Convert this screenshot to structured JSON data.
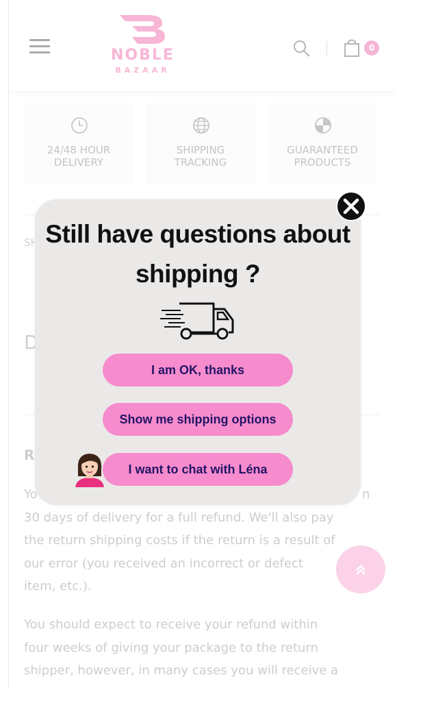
{
  "header": {
    "logo_name": "NOBLE",
    "logo_sub": "BAZAAR",
    "cart_count": "0"
  },
  "features": [
    {
      "icon": "clock-icon",
      "line1": "24/48 HOUR",
      "line2": "DELIVERY"
    },
    {
      "icon": "globe-icon",
      "line1": "SHIPPING",
      "line2": "TRACKING"
    },
    {
      "icon": "shield-icon",
      "line1": "GUARANTEED",
      "line2": "PRODUCTS"
    }
  ],
  "background": {
    "sh_label": "SH",
    "d_heading": "D",
    "r_heading": "R",
    "paragraph1_visible": "Yo\n30 days of delivery for a full refund. We'll also pay\nthe return shipping costs if the return is a result of\nour error (you received an incorrect or defect\nitem, etc.).",
    "paragraph1_right_fragment": "n",
    "paragraph2": "You should expect to receive your refund within\nfour weeks of giving your package to the return\nshipper, however, in many cases you will receive a"
  },
  "popup": {
    "title": "Still have questions about shipping ?",
    "buttons": {
      "ok": "I am OK, thanks",
      "shipping": "Show me shipping options",
      "chat": "I want to chat with Léna"
    }
  },
  "colors": {
    "brand_pink": "#f7b6d6",
    "button_pink": "#f68ccd",
    "button_text": "#231466",
    "popup_bg": "#ebe9e8"
  }
}
